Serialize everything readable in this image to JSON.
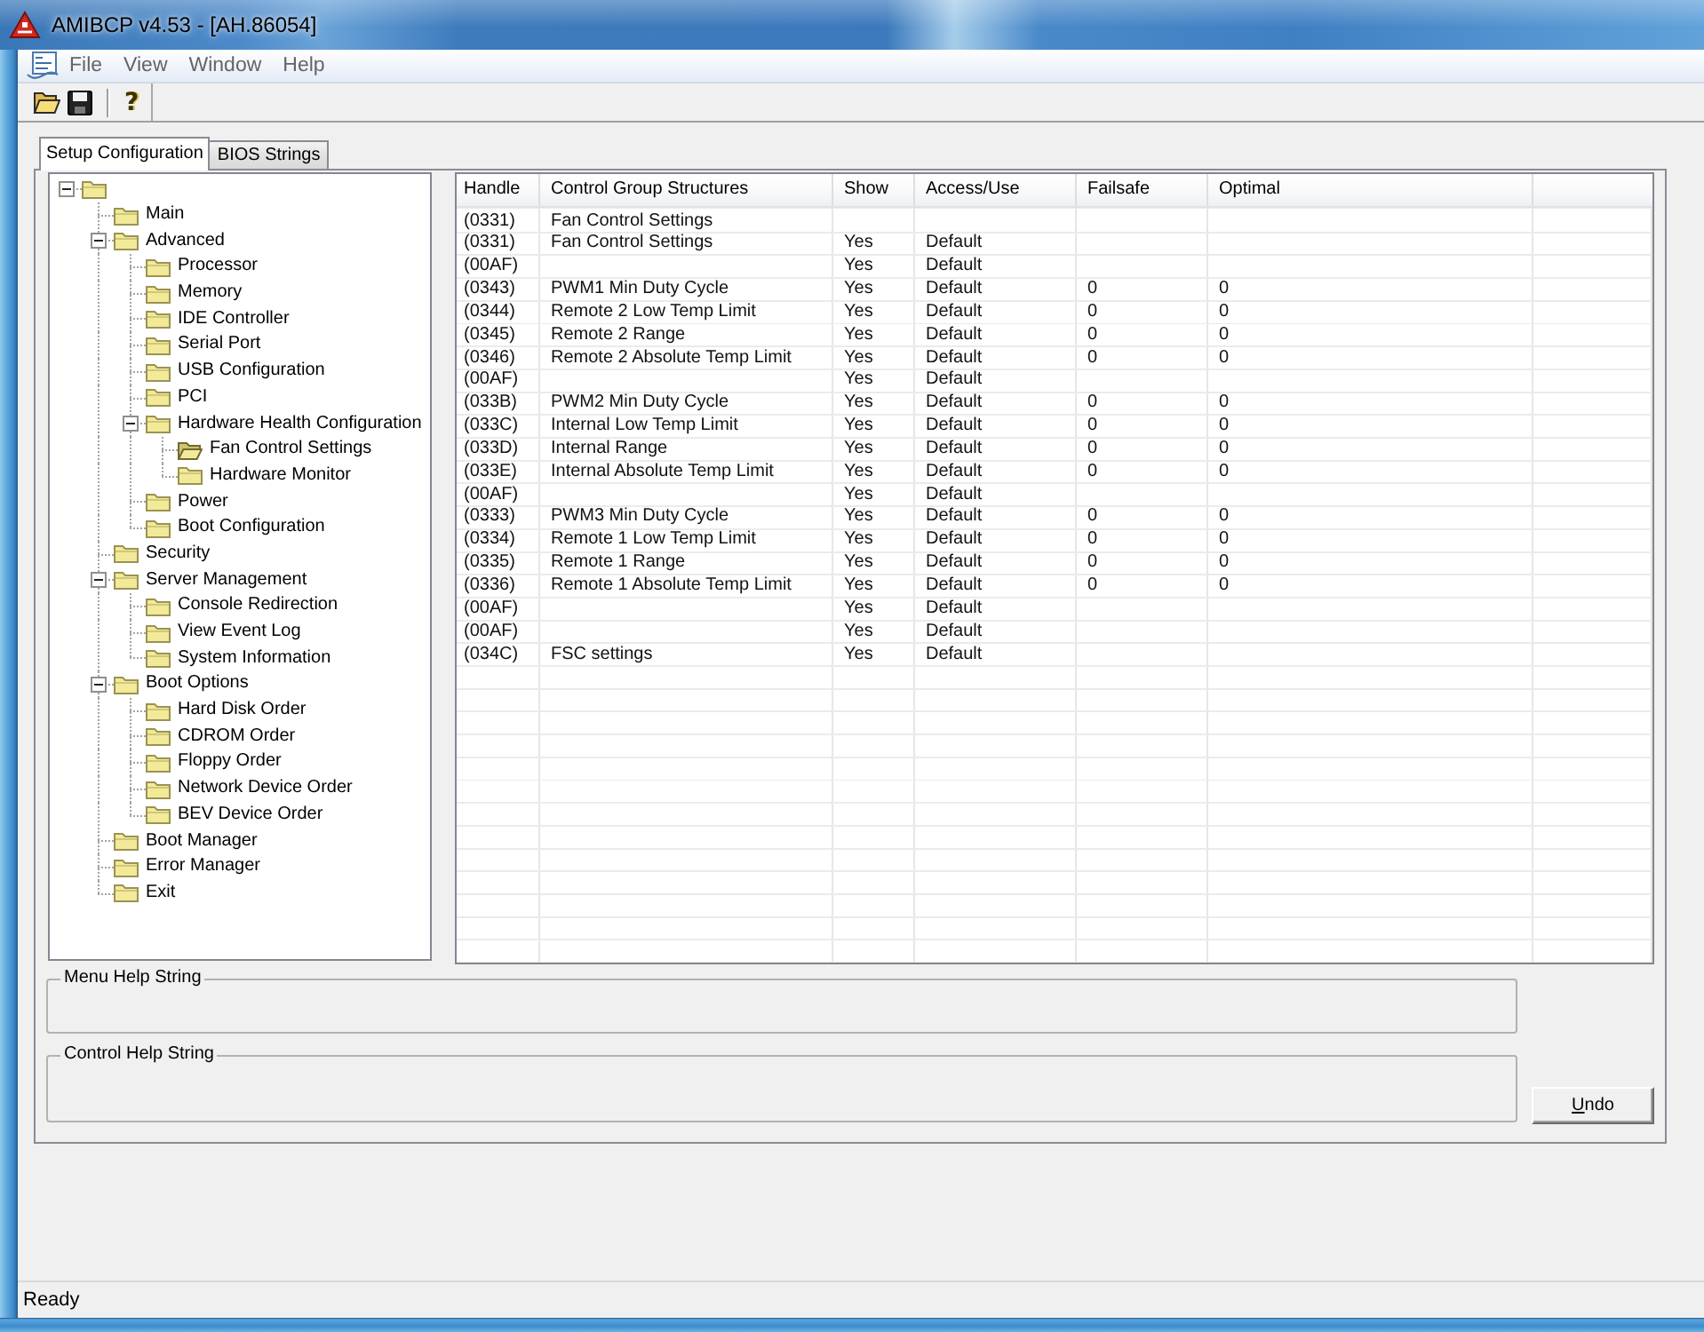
{
  "window": {
    "title": "AMIBCP v4.53 - [AH.86054]"
  },
  "menu": [
    "File",
    "View",
    "Window",
    "Help"
  ],
  "toolbar": {
    "help_button": "?"
  },
  "tabs": [
    {
      "label": "Setup Configuration",
      "selected": true
    },
    {
      "label": "BIOS Strings",
      "selected": false
    }
  ],
  "tree": {
    "selected": false,
    "expanded": true,
    "children": [
      {
        "label": "Main",
        "selected": false
      },
      {
        "label": "Advanced",
        "selected": false,
        "expanded": true,
        "children": [
          {
            "label": "Processor",
            "selected": false
          },
          {
            "label": "Memory",
            "selected": false
          },
          {
            "label": "IDE Controller",
            "selected": false
          },
          {
            "label": "Serial Port",
            "selected": false
          },
          {
            "label": "USB Configuration",
            "selected": false
          },
          {
            "label": "PCI",
            "selected": false
          },
          {
            "label": "Hardware Health Configuration",
            "selected": false,
            "expanded": true,
            "children": [
              {
                "label": "Fan Control Settings",
                "selected": true
              },
              {
                "label": "Hardware Monitor",
                "selected": false
              }
            ]
          },
          {
            "label": "Power",
            "selected": false
          },
          {
            "label": "Boot Configuration",
            "selected": false
          }
        ]
      },
      {
        "label": "Security",
        "selected": false
      },
      {
        "label": "Server Management",
        "selected": false,
        "expanded": true,
        "children": [
          {
            "label": "Console Redirection",
            "selected": false
          },
          {
            "label": "View Event Log",
            "selected": false
          },
          {
            "label": "System Information",
            "selected": false
          }
        ]
      },
      {
        "label": "Boot Options",
        "selected": false,
        "expanded": true,
        "children": [
          {
            "label": "Hard Disk Order",
            "selected": false
          },
          {
            "label": "CDROM Order",
            "selected": false
          },
          {
            "label": "Floppy Order",
            "selected": false
          },
          {
            "label": "Network Device Order",
            "selected": false
          },
          {
            "label": "BEV Device Order",
            "selected": false
          }
        ]
      },
      {
        "label": "Boot Manager",
        "selected": false
      },
      {
        "label": "Error Manager",
        "selected": false
      },
      {
        "label": "Exit",
        "selected": false
      }
    ]
  },
  "table": {
    "columns": [
      "Handle",
      "Control Group Structures",
      "Show",
      "Access/Use",
      "Failsafe",
      "Optimal"
    ],
    "rows": [
      {
        "handle": "(0331)",
        "structure": "Fan Control Settings"
      },
      {
        "handle": "(0331)",
        "structure": "Fan Control Settings",
        "show": "Yes",
        "access": "Default"
      },
      {
        "handle": "(00AF)",
        "show": "Yes",
        "access": "Default"
      },
      {
        "handle": "(0343)",
        "structure": "PWM1 Min Duty Cycle",
        "show": "Yes",
        "access": "Default",
        "failsafe": "0",
        "optimal": "0"
      },
      {
        "handle": "(0344)",
        "structure": "Remote 2 Low Temp Limit",
        "show": "Yes",
        "access": "Default",
        "failsafe": "0",
        "optimal": "0"
      },
      {
        "handle": "(0345)",
        "structure": "Remote 2 Range",
        "show": "Yes",
        "access": "Default",
        "failsafe": "0",
        "optimal": "0"
      },
      {
        "handle": "(0346)",
        "structure": "Remote 2 Absolute Temp Limit",
        "show": "Yes",
        "access": "Default",
        "failsafe": "0",
        "optimal": "0"
      },
      {
        "handle": "(00AF)",
        "show": "Yes",
        "access": "Default"
      },
      {
        "handle": "(033B)",
        "structure": "PWM2 Min Duty Cycle",
        "show": "Yes",
        "access": "Default",
        "failsafe": "0",
        "optimal": "0"
      },
      {
        "handle": "(033C)",
        "structure": "Internal Low Temp Limit",
        "show": "Yes",
        "access": "Default",
        "failsafe": "0",
        "optimal": "0"
      },
      {
        "handle": "(033D)",
        "structure": "Internal Range",
        "show": "Yes",
        "access": "Default",
        "failsafe": "0",
        "optimal": "0"
      },
      {
        "handle": "(033E)",
        "structure": "Internal Absolute Temp Limit",
        "show": "Yes",
        "access": "Default",
        "failsafe": "0",
        "optimal": "0"
      },
      {
        "handle": "(00AF)",
        "show": "Yes",
        "access": "Default"
      },
      {
        "handle": "(0333)",
        "structure": "PWM3 Min Duty Cycle",
        "show": "Yes",
        "access": "Default",
        "failsafe": "0",
        "optimal": "0"
      },
      {
        "handle": "(0334)",
        "structure": "Remote 1 Low Temp Limit",
        "show": "Yes",
        "access": "Default",
        "failsafe": "0",
        "optimal": "0"
      },
      {
        "handle": "(0335)",
        "structure": "Remote 1 Range",
        "show": "Yes",
        "access": "Default",
        "failsafe": "0",
        "optimal": "0"
      },
      {
        "handle": "(0336)",
        "structure": "Remote 1 Absolute Temp Limit",
        "show": "Yes",
        "access": "Default",
        "failsafe": "0",
        "optimal": "0"
      },
      {
        "handle": "(00AF)",
        "show": "Yes",
        "access": "Default"
      },
      {
        "handle": "(00AF)",
        "show": "Yes",
        "access": "Default"
      },
      {
        "handle": "(034C)",
        "structure": "FSC settings",
        "show": "Yes",
        "access": "Default"
      }
    ]
  },
  "help_panels": [
    {
      "label": "Menu Help String"
    },
    {
      "label": "Control Help String"
    }
  ],
  "undo_button": {
    "label": "Undo"
  },
  "status_bar": {
    "text": "Ready"
  }
}
